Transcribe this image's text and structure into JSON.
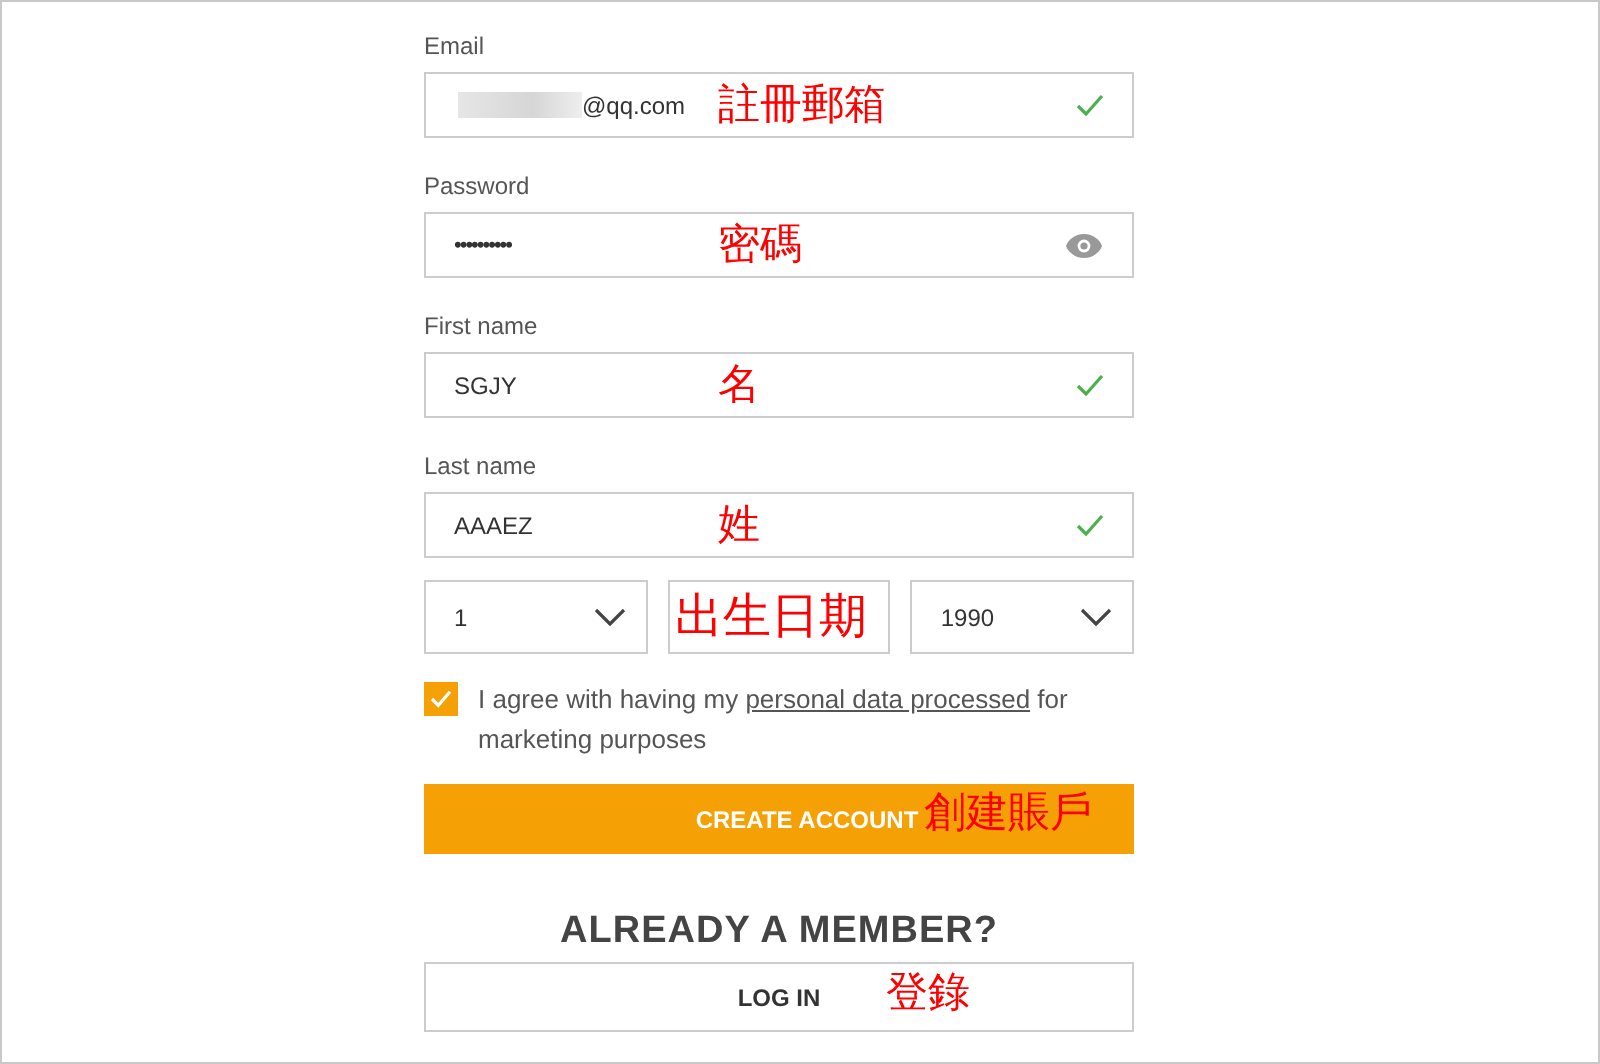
{
  "fields": [
    {
      "kind": "email",
      "label": "Email",
      "value": "@qq.com",
      "redacted": true,
      "valid": true,
      "annotation": "註冊郵箱"
    },
    {
      "kind": "password",
      "label": "Password",
      "value": "••••••••••",
      "annotation": "密碼"
    },
    {
      "kind": "text",
      "label": "First name",
      "value": "SGJY",
      "valid": true,
      "annotation": "名"
    },
    {
      "kind": "text",
      "label": "Last name",
      "value": "AAAEZ",
      "valid": true,
      "annotation": "姓"
    }
  ],
  "birth_date": {
    "selects": [
      {
        "value": "1"
      },
      {
        "annotation": "出生日期"
      },
      {
        "value": "1990"
      }
    ]
  },
  "consent": {
    "checked": true,
    "text_before": "I agree with having my",
    "link": "personal data processed",
    "text_after": "for marketing purposes"
  },
  "create_account": {
    "label": "CREATE ACCOUNT",
    "annotation": "創建賬戶"
  },
  "already_member": "ALREADY A MEMBER?",
  "login": {
    "label": "LOG IN",
    "annotation": "登錄"
  }
}
